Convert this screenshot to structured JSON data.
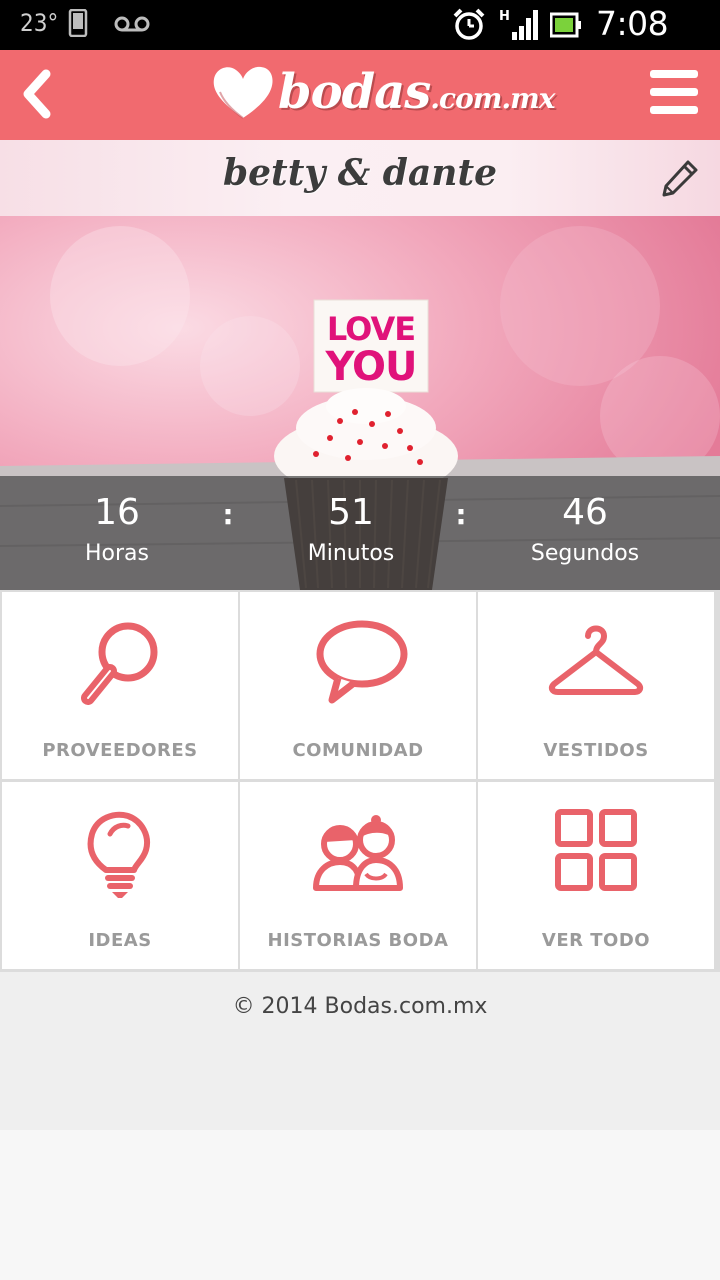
{
  "status_bar": {
    "temperature": "23°",
    "network": "H",
    "time": "7:08 am"
  },
  "header": {
    "brand": "bodas",
    "brand_suffix": ".com.mx",
    "accent_color": "#f16a6f"
  },
  "couple": {
    "names": "betty & dante"
  },
  "hero": {
    "card_line1": "LOVE",
    "card_line2": "YOU"
  },
  "countdown": {
    "hours": "16",
    "hours_label": "Horas",
    "minutes": "51",
    "minutes_label": "Minutos",
    "seconds": "46",
    "seconds_label": "Segundos",
    "separator": ":"
  },
  "grid": {
    "items": [
      {
        "label": "PROVEEDORES",
        "icon": "magnifier-icon"
      },
      {
        "label": "COMUNIDAD",
        "icon": "speech-bubble-icon"
      },
      {
        "label": "VESTIDOS",
        "icon": "hanger-icon"
      },
      {
        "label": "IDEAS",
        "icon": "lightbulb-icon"
      },
      {
        "label": "HISTORIAS BODA",
        "icon": "couple-icon"
      },
      {
        "label": "VER TODO",
        "icon": "grid-icon"
      }
    ],
    "icon_color": "#e9636a"
  },
  "footer": {
    "copyright": "© 2014 Bodas.com.mx"
  }
}
